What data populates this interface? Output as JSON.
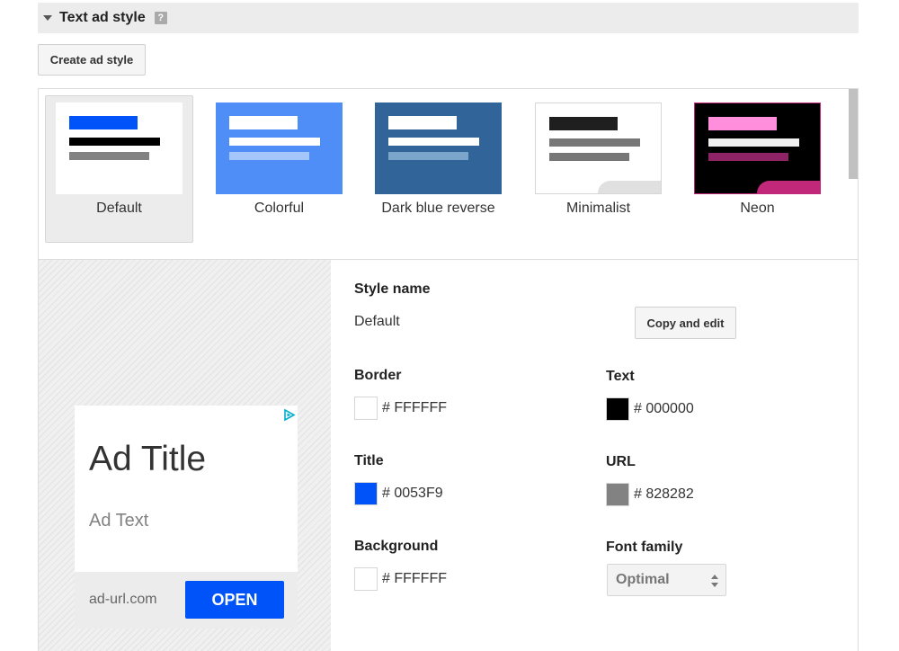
{
  "header": {
    "title": "Text ad style",
    "help_icon": "?"
  },
  "create_button": "Create ad style",
  "styles": [
    {
      "label": "Default",
      "selected": true,
      "bg": "#ffffff",
      "accent": "#0053f9",
      "line1": "#000000",
      "line2": "#828282"
    },
    {
      "label": "Colorful",
      "selected": false,
      "bg": "#4f8ef7",
      "accent": "#ffffff",
      "line1": "#ffffff",
      "line2": "#a5c6fb"
    },
    {
      "label": "Dark blue reverse",
      "selected": false,
      "bg": "#31659a",
      "accent": "#ffffff",
      "line1": "#ffffff",
      "line2": "#7ca5cb"
    },
    {
      "label": "Minimalist",
      "selected": false,
      "bg": "#ffffff",
      "accent": "#1f1f1f",
      "line1": "#777777",
      "line2": "#777777"
    },
    {
      "label": "Neon",
      "selected": false,
      "bg": "#000000",
      "accent": "#ff8edc",
      "line1": "#f0f0f0",
      "line2": "#8e2466"
    }
  ],
  "preview": {
    "ad_title": "Ad Title",
    "ad_text": "Ad Text",
    "ad_url": "ad-url.com",
    "open_button": "OPEN"
  },
  "settings": {
    "style_name_label": "Style name",
    "style_name_value": "Default",
    "copy_edit_button": "Copy and edit",
    "border": {
      "label": "Border",
      "hash": "#",
      "hex": "FFFFFF",
      "color": "#ffffff"
    },
    "text": {
      "label": "Text",
      "hash": "#",
      "hex": "000000",
      "color": "#000000"
    },
    "title": {
      "label": "Title",
      "hash": "#",
      "hex": "0053F9",
      "color": "#0053f9"
    },
    "url": {
      "label": "URL",
      "hash": "#",
      "hex": "828282",
      "color": "#828282"
    },
    "background": {
      "label": "Background",
      "hash": "#",
      "hex": "FFFFFF",
      "color": "#ffffff"
    },
    "font_family": {
      "label": "Font family",
      "value": "Optimal"
    }
  }
}
